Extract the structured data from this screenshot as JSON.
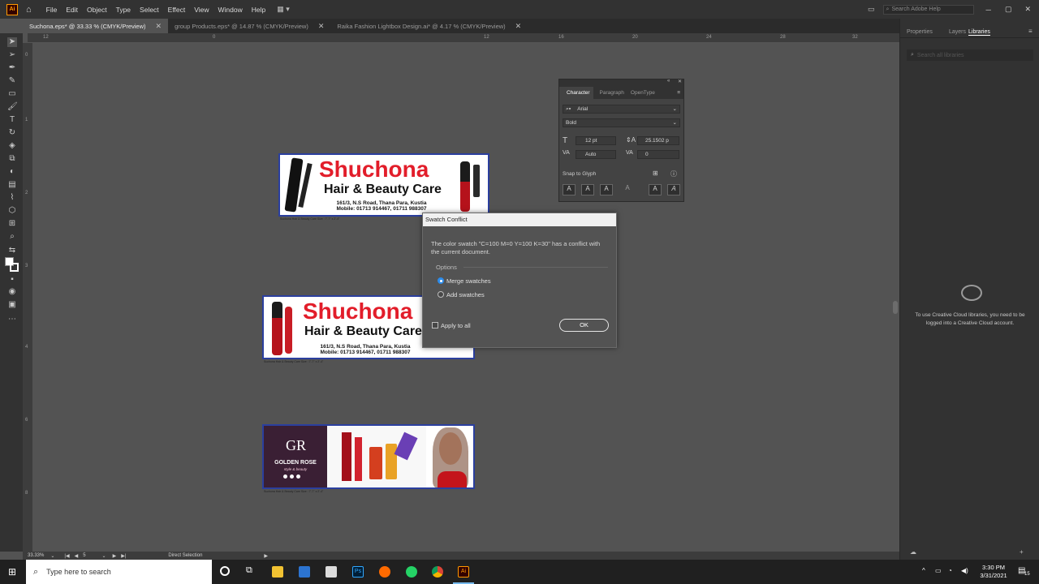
{
  "app": {
    "logo": "Ai",
    "menu": [
      "File",
      "Edit",
      "Object",
      "Type",
      "Select",
      "Effect",
      "View",
      "Window",
      "Help"
    ],
    "search_placeholder": "Search Adobe Help"
  },
  "tabs": [
    {
      "label": "Suchona.eps* @ 33.33 % (CMYK/Preview)",
      "active": true
    },
    {
      "label": "group Products.eps* @ 14.87 % (CMYK/Preview)",
      "active": false
    },
    {
      "label": "Raika Fashion Lightbox Design.ai* @ 4.17 % (CMYK/Preview)",
      "active": false
    }
  ],
  "ruler": {
    "h_ticks": [
      "12",
      "0",
      "12",
      "16",
      "20",
      "24",
      "28",
      "32"
    ],
    "v_ticks": [
      "0",
      "1",
      "2",
      "3",
      "4",
      "6",
      "8",
      "4"
    ]
  },
  "artboards": {
    "banner1": {
      "brand": "Shuchona",
      "sub": "Hair & Beauty Care",
      "address": "161/3, N.S Road, Thana Para, Kustia",
      "mobile": "Mobile: 01713 914467, 01711 988307",
      "caption": "Suchona Hair & Beauty Care Size : 7'-7\" x 2'-4\""
    },
    "banner2": {
      "brand": "Shuchona",
      "sub": "Hair & Beauty Care",
      "address": "161/3, N.S Road, Thana Para, Kustia",
      "mobile": "Mobile: 01713 914467, 01711 988307",
      "caption": "Suchona Hair & Beauty Care Size : 7'-7\" x 2'-4\""
    },
    "banner3": {
      "logo_text": "GR",
      "brand": "GOLDEN ROSE",
      "tagline": "style & beauty",
      "caption": "Suchona Hair & Beauty Care Size : 7'-7\" x 2'-4\""
    }
  },
  "dialog": {
    "title": "Swatch Conflict",
    "message": "The color swatch \"C=100 M=0 Y=100 K=30\" has a conflict with the current document.",
    "options_label": "Options",
    "merge_label": "Merge swatches",
    "add_label": "Add swatches",
    "merge_selected": true,
    "apply_all_label": "Apply to all",
    "apply_all_checked": false,
    "ok_label": "OK"
  },
  "character_panel": {
    "tabs": [
      "Character",
      "Paragraph",
      "OpenType"
    ],
    "font_family": "Arial",
    "font_style": "Bold",
    "font_size": "12 pt",
    "leading": "25.1502 p",
    "kerning": "Auto",
    "tracking": "0",
    "snap_label": "Snap to Glyph"
  },
  "right_panel": {
    "tabs": [
      "Properties",
      "Layers",
      "Libraries"
    ],
    "active_tab": "Libraries",
    "search_placeholder": "Search all libraries",
    "message": "To use Creative Cloud libraries, you need to be logged into a Creative Cloud account."
  },
  "status": {
    "zoom": "33.33%",
    "artboard_number": "5",
    "tool": "Direct Selection"
  },
  "taskbar": {
    "search_placeholder": "Type here to search",
    "time": "3:30 PM",
    "date": "3/31/2021",
    "notification_count": "15"
  },
  "colors": {
    "accent_blue": "#2d8ceb",
    "brand_red": "#e21d2a",
    "illustrator_orange": "#ff9a00",
    "golden_rose_purple": "#3a1f34"
  }
}
